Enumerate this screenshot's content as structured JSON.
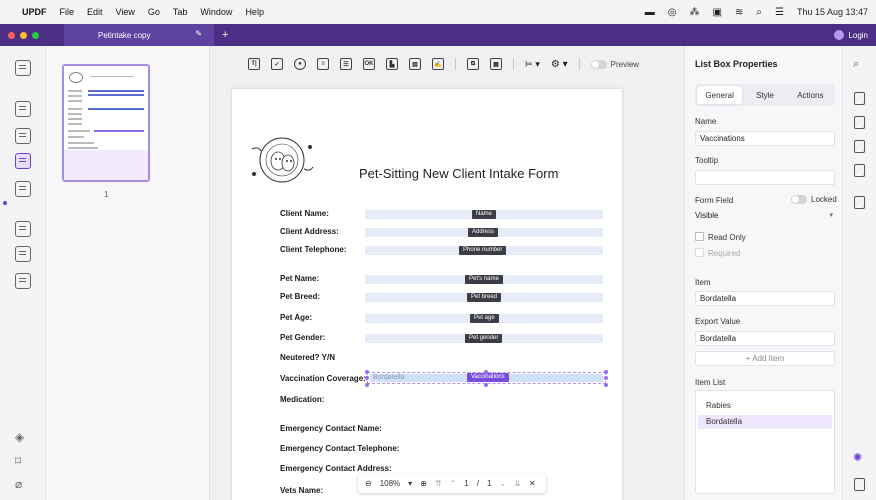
{
  "menubar": {
    "app": "UPDF",
    "items": [
      "File",
      "Edit",
      "View",
      "Go",
      "Tab",
      "Window",
      "Help"
    ],
    "datetime": "Thu 15 Aug 13:47"
  },
  "tabbar": {
    "tab_title": "Petintake copy",
    "login": "Login",
    "colors": {
      "bar": "#4b2f87",
      "close": "#ff5f57",
      "min": "#febc2e",
      "max": "#28c840"
    }
  },
  "thumbnails": {
    "page_number": "1"
  },
  "toolbar": {
    "preview_label": "Preview",
    "text_icon": "T|",
    "button_icon": "OK"
  },
  "form": {
    "title": "Pet-Sitting New Client Intake Form",
    "logo_text": "MELVER'S HAPPY TAILS · SOMERSET PET-SITTING SERVICES",
    "rows": [
      {
        "label": "Client Name:",
        "tag": "Name"
      },
      {
        "label": "Client Address:",
        "tag": "Address"
      },
      {
        "label": "Client Telephone:",
        "tag": "Phone number"
      },
      {
        "label": "Pet Name:",
        "tag": "Pet's name"
      },
      {
        "label": "Pet Breed:",
        "tag": "Pet breed"
      },
      {
        "label": "Pet Age:",
        "tag": "Pet age"
      },
      {
        "label": "Pet Gender:",
        "tag": "Pet gender"
      }
    ],
    "neutered": "Neutered? Y/N",
    "vaccination_label": "Vaccination Coverage:",
    "vaccination_value": "Bordatella",
    "vaccination_tag": "Vaccinations",
    "medication": "Medication:",
    "emergency_name": "Emergency Contact Name:",
    "emergency_phone": "Emergency Contact Telephone:",
    "emergency_address": "Emergency Contact Address:",
    "vets_name": "Vets Name:"
  },
  "zoombar": {
    "zoom": "108%",
    "current_page": "1",
    "separator": "/",
    "total_pages": "1"
  },
  "properties": {
    "title": "List Box Properties",
    "tabs": [
      "General",
      "Style",
      "Actions"
    ],
    "name_label": "Name",
    "name_value": "Vaccinations",
    "tooltip_label": "Tooltip",
    "tooltip_value": "",
    "form_field_label": "Form Field",
    "locked_label": "Locked",
    "visibility": "Visible",
    "read_only": "Read Only",
    "required": "Required",
    "item_label": "Item",
    "item_value": "Bordatella",
    "export_label": "Export Value",
    "export_value": "Bordatella",
    "add_item": "+ Add Item",
    "item_list_label": "Item List",
    "item_list": [
      "Rabies",
      "Bordatella"
    ]
  }
}
